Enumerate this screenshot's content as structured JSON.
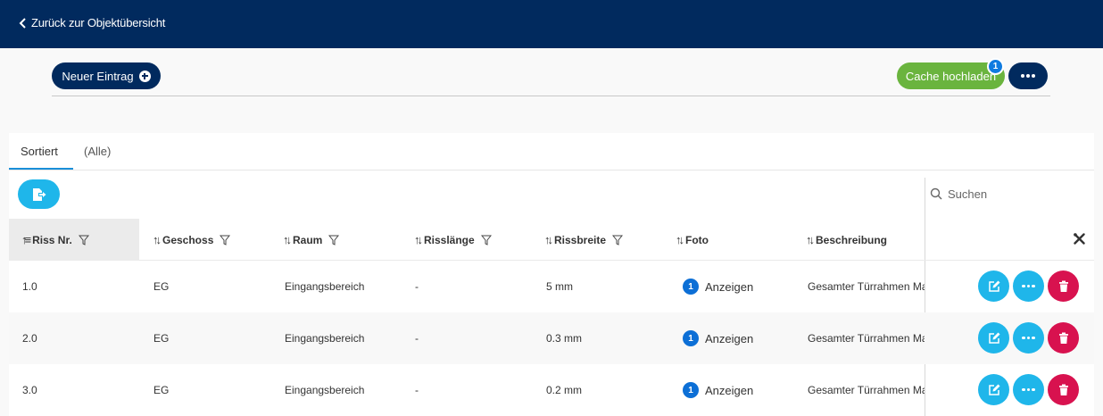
{
  "nav": {
    "back_label": "Zurück zur Objektübersicht"
  },
  "toolbar": {
    "new_entry_label": "Neuer Eintrag",
    "cache_upload_label": "Cache hochladen",
    "cache_badge": "1"
  },
  "tabs": [
    {
      "label": "Sortiert"
    },
    {
      "label": "(Alle)"
    }
  ],
  "search": {
    "placeholder": "Suchen"
  },
  "columns": [
    {
      "label": "Riss Nr."
    },
    {
      "label": "Geschoss"
    },
    {
      "label": "Raum"
    },
    {
      "label": "Risslänge"
    },
    {
      "label": "Rissbreite"
    },
    {
      "label": "Foto"
    },
    {
      "label": "Beschreibung"
    }
  ],
  "rows": [
    {
      "nr": "1.0",
      "geschoss": "EG",
      "raum": "Eingangsbereich",
      "laenge": "-",
      "breite": "5 mm",
      "foto_count": "1",
      "foto_label": "Anzeigen",
      "beschreibung": "Gesamter Türrahmen Mat"
    },
    {
      "nr": "2.0",
      "geschoss": "EG",
      "raum": "Eingangsbereich",
      "laenge": "-",
      "breite": "0.3 mm",
      "foto_count": "1",
      "foto_label": "Anzeigen",
      "beschreibung": "Gesamter Türrahmen Mat"
    },
    {
      "nr": "3.0",
      "geschoss": "EG",
      "raum": "Eingangsbereich",
      "laenge": "-",
      "breite": "0.2 mm",
      "foto_count": "1",
      "foto_label": "Anzeigen",
      "beschreibung": "Gesamter Türrahmen Mat"
    }
  ],
  "colors": {
    "navy": "#012a5e",
    "green": "#6ab43e",
    "cyan": "#1fb6ea",
    "red": "#d8124f",
    "badge_blue": "#0f7be0"
  }
}
